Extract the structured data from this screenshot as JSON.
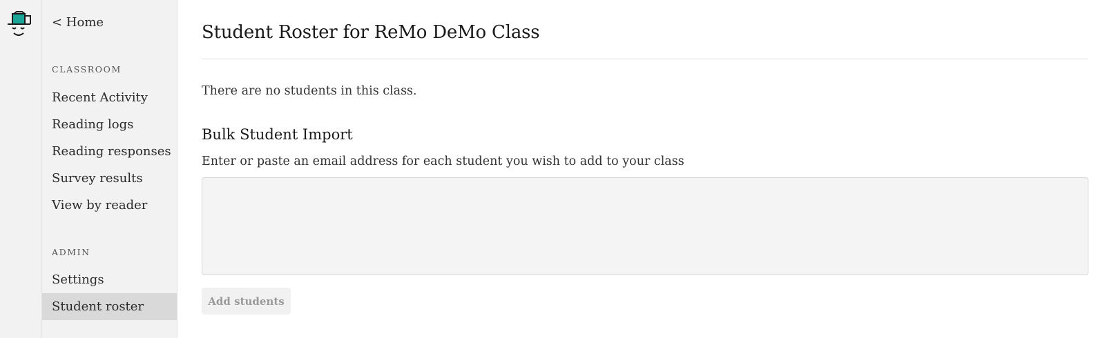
{
  "logo": {
    "icon": "remo-logo-icon",
    "accent_color": "#1aa598"
  },
  "sidebar": {
    "home_link": "< Home",
    "sections": [
      {
        "label": "CLASSROOM",
        "items": [
          {
            "label": "Recent Activity",
            "active": false
          },
          {
            "label": "Reading logs",
            "active": false
          },
          {
            "label": "Reading responses",
            "active": false
          },
          {
            "label": "Survey results",
            "active": false
          },
          {
            "label": "View by reader",
            "active": false
          }
        ]
      },
      {
        "label": "ADMIN",
        "items": [
          {
            "label": "Settings",
            "active": false
          },
          {
            "label": "Student roster",
            "active": true
          }
        ]
      }
    ]
  },
  "main": {
    "title": "Student Roster for ReMo DeMo Class",
    "empty_message": "There are no students in this class.",
    "bulk_import": {
      "title": "Bulk Student Import",
      "instructions": "Enter or paste an email address for each student you wish to add to your class",
      "textarea_value": "",
      "button_label": "Add students"
    }
  }
}
